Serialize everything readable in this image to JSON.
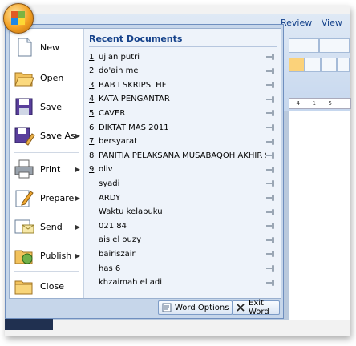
{
  "ribbon": {
    "tabs": [
      "Review",
      "View"
    ]
  },
  "ruler_text": "· 4 · · · 1 · · · 5",
  "menu": {
    "commands": [
      {
        "label": "New",
        "has_submenu": false,
        "icon": "new-document-icon"
      },
      {
        "label": "Open",
        "has_submenu": false,
        "icon": "open-folder-icon"
      },
      {
        "label": "Save",
        "has_submenu": false,
        "icon": "save-disk-icon"
      },
      {
        "label": "Save As",
        "has_submenu": true,
        "icon": "save-as-icon"
      },
      {
        "label": "Print",
        "has_submenu": true,
        "icon": "printer-icon"
      },
      {
        "label": "Prepare",
        "has_submenu": true,
        "icon": "prepare-pencil-icon"
      },
      {
        "label": "Send",
        "has_submenu": true,
        "icon": "send-mail-icon"
      },
      {
        "label": "Publish",
        "has_submenu": true,
        "icon": "publish-icon"
      },
      {
        "label": "Close",
        "has_submenu": false,
        "icon": "close-folder-icon"
      }
    ],
    "submenu_arrow": "▶"
  },
  "recent": {
    "title": "Recent Documents",
    "items": [
      {
        "num": "1",
        "name": "ujian putri"
      },
      {
        "num": "2",
        "name": "do'ain me"
      },
      {
        "num": "3",
        "name": "BAB I SKRIPSI HF"
      },
      {
        "num": "4",
        "name": "KATA PENGANTAR"
      },
      {
        "num": "5",
        "name": "CAVER"
      },
      {
        "num": "6",
        "name": "DIKTAT MAS 2011"
      },
      {
        "num": "7",
        "name": "bersyarat"
      },
      {
        "num": "8",
        "name": "PANITIA PELAKSANA MUSABAQOH AKHIR SANAH"
      },
      {
        "num": "9",
        "name": "oliv"
      },
      {
        "num": "",
        "name": "syadi"
      },
      {
        "num": "",
        "name": "ARDY"
      },
      {
        "num": "",
        "name": "Waktu kelabuku"
      },
      {
        "num": "",
        "name": "021 84"
      },
      {
        "num": "",
        "name": "ais el ouzy"
      },
      {
        "num": "",
        "name": "bairiszair"
      },
      {
        "num": "",
        "name": "has 6"
      },
      {
        "num": "",
        "name": "khzaimah el adi"
      }
    ]
  },
  "footer": {
    "word_options": "Word Options",
    "exit_word": "Exit Word"
  }
}
